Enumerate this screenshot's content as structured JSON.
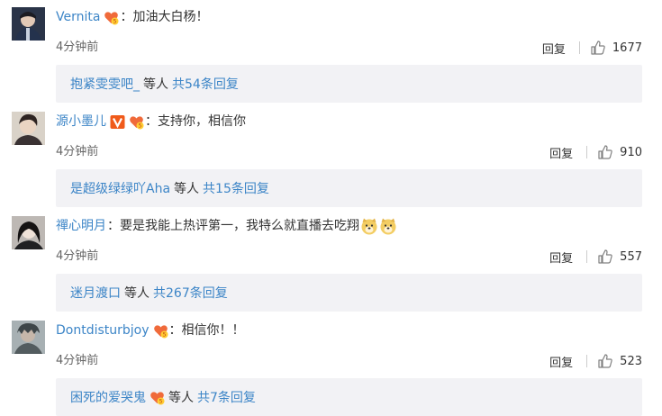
{
  "comments": [
    {
      "username": "Vernita",
      "badges": [
        "vip-heart-icon"
      ],
      "text": "加油大白杨！",
      "emojis": [],
      "time": "4分钟前",
      "reply_label": "回复",
      "likes": "1677",
      "reply_box": {
        "user": "抱紧雯雯吧_",
        "mid": "等人",
        "count": "共54条回复",
        "badges": []
      }
    },
    {
      "username": "源小墨儿",
      "badges": [
        "verified-v-icon",
        "vip-heart-icon"
      ],
      "text": "支持你，相信你",
      "emojis": [],
      "time": "4分钟前",
      "reply_label": "回复",
      "likes": "910",
      "reply_box": {
        "user": "是超级绿绿吖Aha",
        "mid": "等人",
        "count": "共15条回复",
        "badges": []
      }
    },
    {
      "username": "禪心明月",
      "badges": [],
      "text": "要是我能上热评第一，我特么就直播去吃翔",
      "emojis": [
        "doge-emoji-icon",
        "doge-emoji-icon"
      ],
      "time": "4分钟前",
      "reply_label": "回复",
      "likes": "557",
      "reply_box": {
        "user": "迷月渡口",
        "mid": "等人",
        "count": "共267条回复",
        "badges": []
      }
    },
    {
      "username": "Dontdisturbjoy",
      "badges": [
        "vip-heart-icon"
      ],
      "text": "相信你！！",
      "emojis": [],
      "time": "4分钟前",
      "reply_label": "回复",
      "likes": "523",
      "reply_box": {
        "user": "困死的爱哭鬼",
        "mid": "等人",
        "count": "共7条回复",
        "badges": [
          "vip-heart-icon"
        ]
      }
    }
  ],
  "colors": {
    "link": "#3c85c7",
    "text": "#333333",
    "reply_bg": "#f2f2f5"
  }
}
